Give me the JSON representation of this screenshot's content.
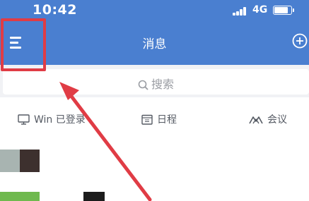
{
  "status_bar": {
    "time": "10:42",
    "network": "4G",
    "icons": [
      "signal-icon",
      "battery-icon"
    ]
  },
  "nav_bar": {
    "title": "消息",
    "left_icon": "menu-icon",
    "right_icon": "add-circle-icon"
  },
  "search": {
    "placeholder": "搜索",
    "icon": "search-icon"
  },
  "quick_bar": {
    "items": [
      {
        "label": "Win 已登录",
        "icon": "monitor-icon"
      },
      {
        "label": "日程",
        "icon": "calendar-icon"
      },
      {
        "label": "会议",
        "icon": "meeting-icon"
      }
    ]
  },
  "annotation": {
    "color": "#e03c45",
    "shapes": [
      "highlight-box",
      "arrow"
    ]
  },
  "colors": {
    "header": "#4a7fd0",
    "search_bg": "#f1f2f5",
    "highlight": "#e03c45"
  }
}
